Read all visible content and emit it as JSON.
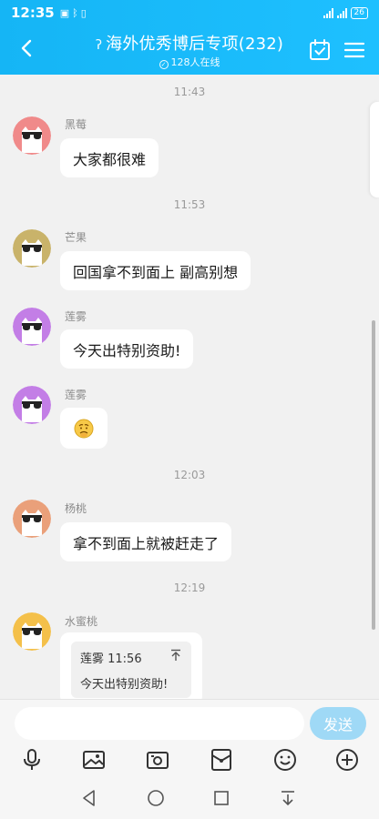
{
  "status": {
    "time": "12:35",
    "battery": "26"
  },
  "header": {
    "title": "海外优秀博后专项(232)",
    "subtitle": "128人在线"
  },
  "messages": [
    {
      "time": "11:43"
    },
    {
      "sender": "黑莓",
      "text": "大家都很难",
      "avatar_color": "#f08a8a"
    },
    {
      "time": "11:53"
    },
    {
      "sender": "芒果",
      "text": "回国拿不到面上 副高别想",
      "avatar_color": "#c9b36a"
    },
    {
      "sender": "莲雾",
      "text": "今天出特别资助!",
      "avatar_color": "#c37ee6"
    },
    {
      "sender": "莲雾",
      "emoji": "worried-face",
      "avatar_color": "#c37ee6"
    },
    {
      "time": "12:03"
    },
    {
      "sender": "杨桃",
      "text": "拿不到面上就被赶走了",
      "avatar_color": "#eaa07a"
    },
    {
      "time": "12:19"
    },
    {
      "sender": "水蜜桃",
      "quote": {
        "author_time": "莲雾 11:56",
        "text": "今天出特别资助!"
      },
      "avatar_color": "#f4c04a"
    }
  ],
  "input": {
    "placeholder": "",
    "send_label": "发送"
  },
  "colors": {
    "header": "#1bbcff",
    "send_disabled": "#9fd9f6"
  }
}
